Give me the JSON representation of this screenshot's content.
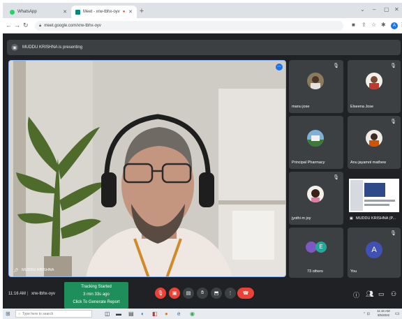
{
  "browser": {
    "tabs": [
      {
        "label": "WhatsApp"
      },
      {
        "label": "Meet - xrw-tbhx-oyv"
      }
    ],
    "url": "meet.google.com/xrw-tbhx-oyv"
  },
  "presenting_banner": "MUDDU KRISHNA is presenting",
  "main_video": {
    "name": "MUDDU KRISHNA"
  },
  "participants": [
    {
      "name": "manu jose"
    },
    {
      "name": "Elseena Jose"
    },
    {
      "name": "Principal Pharmacy"
    },
    {
      "name": "Anu jayamol mathew"
    },
    {
      "name": "jyothi m joy"
    },
    {
      "name": "MUDDU KRISHNA (P..."
    },
    {
      "name": "73 others",
      "avatar_letter": "E"
    },
    {
      "name": "You",
      "avatar_letter": "A"
    }
  ],
  "meeting_info": {
    "time": "11:16 AM",
    "code": "xrw-tbhx-oyv"
  },
  "tracking": {
    "line1": "Tracking Started",
    "line2": "3 min 33s ago",
    "line3": "Click To Generate Report"
  },
  "taskbar": {
    "search_placeholder": "Type here to search",
    "clock_time": "11:16 AM",
    "clock_date": "3/5/2022"
  },
  "colors": {
    "accent_blue": "#8ab4f8",
    "end_call_red": "#ea4335",
    "tracking_green": "#1e8e5a",
    "you_avatar": "#3f51b5"
  }
}
